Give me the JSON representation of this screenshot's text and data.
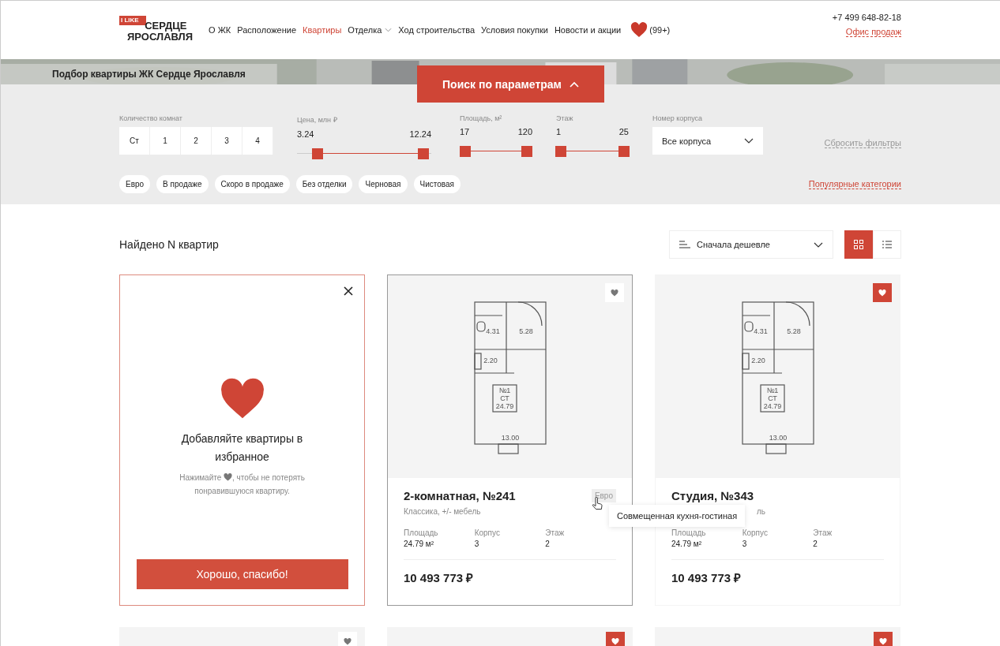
{
  "header": {
    "logo": {
      "badge": "I LIKE",
      "line1": "СЕРДЦЕ",
      "line2": "ЯРОСЛАВЛЯ"
    },
    "nav": [
      {
        "label": "О ЖК",
        "selected": false,
        "dropdown": false
      },
      {
        "label": "Расположение",
        "selected": false,
        "dropdown": false
      },
      {
        "label": "Квартиры",
        "selected": true,
        "dropdown": false
      },
      {
        "label": "Отделка",
        "selected": false,
        "dropdown": true
      },
      {
        "label": "Ход строительства",
        "selected": false,
        "dropdown": false
      },
      {
        "label": "Условия покупки",
        "selected": false,
        "dropdown": false
      },
      {
        "label": "Новости и акции",
        "selected": false,
        "dropdown": false
      }
    ],
    "favorites_count": "(99+)",
    "phone": "+7 499 648-82-18",
    "office_link": "Офис продаж"
  },
  "banner": {
    "title": "Подбор квартиры ЖК Сердце Ярославля",
    "search_button": "Поиск по параметрам",
    "expanded": true
  },
  "filters": {
    "rooms": {
      "label": "Количество комнат",
      "options": [
        {
          "label": "Ст",
          "selected": false
        },
        {
          "label": "1",
          "selected": false
        },
        {
          "label": "2",
          "selected": false
        },
        {
          "label": "3",
          "selected": false
        },
        {
          "label": "4",
          "selected": false
        }
      ]
    },
    "ranges": [
      {
        "label": "Цена, млн ₽",
        "min": "3.24",
        "max": "12.24",
        "handles": [
          {
            "level": 0.15
          },
          {
            "level": 0.94
          }
        ]
      },
      {
        "label": "Площадь, м²",
        "min": "17",
        "max": "120",
        "handles": [
          {
            "level": 0.08
          },
          {
            "level": 0.92
          }
        ]
      },
      {
        "label": "Этаж",
        "min": "1",
        "max": "25",
        "handles": [
          {
            "level": 0.07
          },
          {
            "level": 0.93
          }
        ]
      }
    ],
    "building": {
      "label": "Номер корпуса",
      "value": "Все корпуса"
    },
    "reset": "Сбросить фильтры",
    "chips": [
      {
        "label": "Евро",
        "selected": false
      },
      {
        "label": "В продаже",
        "selected": false
      },
      {
        "label": "Скоро в продаже",
        "selected": false
      },
      {
        "label": "Без отделки",
        "selected": false
      },
      {
        "label": "Черновая",
        "selected": false
      },
      {
        "label": "Чистовая",
        "selected": false
      }
    ],
    "popular": "Популярные категории"
  },
  "results": {
    "found": "Найдено N квартир",
    "sort": "Сначала дешевле",
    "view": [
      {
        "kind": "grid",
        "selected": true
      },
      {
        "kind": "list",
        "selected": false
      }
    ]
  },
  "promo": {
    "title": "Добавляйте квартиры в избранное",
    "text_before": "Нажимайте",
    "text_after": ", чтобы не потерять понравившуюся квартиру.",
    "button": "Хорошо, спасибо!"
  },
  "cards": [
    {
      "favorite": false,
      "hovered": true,
      "plan_labels": [
        "4.31",
        "5.28",
        "2.20",
        "№1",
        "СТ",
        "24.79",
        "13.00"
      ],
      "title": "2-комнатная, №241",
      "subtitle": "Классика, +/- мебель",
      "tag": "Евро",
      "tooltip": "Совмещенная кухня-гостиная",
      "stats": [
        {
          "label": "Площадь",
          "value": "24.79 м²"
        },
        {
          "label": "Корпус",
          "value": "3"
        },
        {
          "label": "Этаж",
          "value": "2"
        }
      ],
      "price": "10 493 773 ₽"
    },
    {
      "favorite": true,
      "hovered": false,
      "plan_labels": [
        "4.31",
        "5.28",
        "2.20",
        "№1",
        "СТ",
        "24.79",
        "13.00"
      ],
      "title": "Студия, №343",
      "subtitle_tail": "ль",
      "stats": [
        {
          "label": "Площадь",
          "value": "24.79 м²"
        },
        {
          "label": "Корпус",
          "value": "3"
        },
        {
          "label": "Этаж",
          "value": "2"
        }
      ],
      "price": "10 493 773 ₽"
    }
  ],
  "more_cards": [
    {
      "favorite": false
    },
    {
      "favorite": true
    },
    {
      "favorite": true
    }
  ]
}
